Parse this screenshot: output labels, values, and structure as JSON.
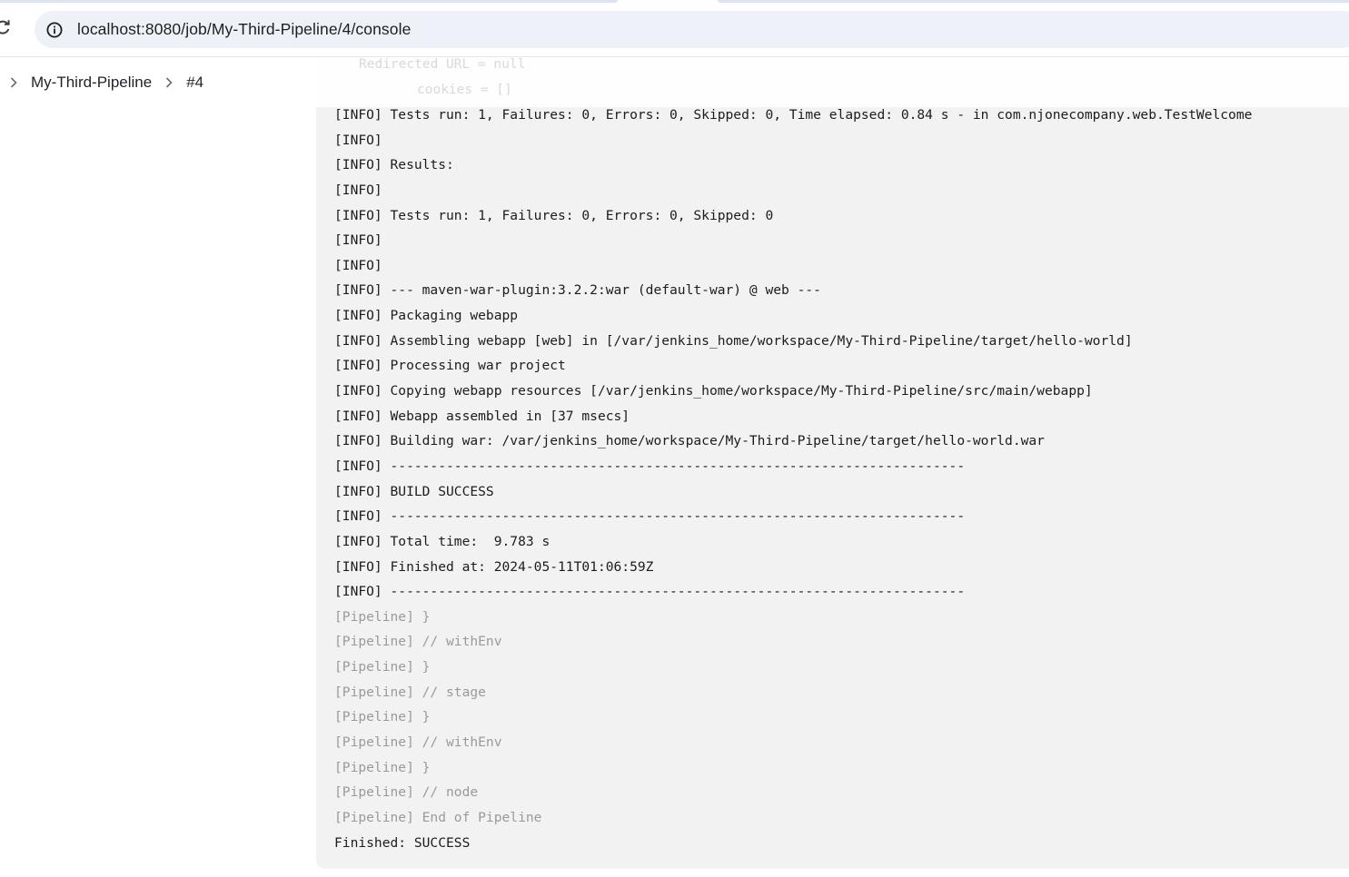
{
  "browser": {
    "url": "localhost:8080/job/My-Third-Pipeline/4/console",
    "reload_icon": "reload-icon",
    "site_info_icon": "info-circle-icon"
  },
  "breadcrumb": {
    "items": [
      {
        "label": "My-Third-Pipeline"
      },
      {
        "label": "#4"
      }
    ],
    "separator_icon": "chevron-right-icon"
  },
  "ghost_text": {
    "line1": "Redirected URL = null",
    "line2": "cookies = []"
  },
  "console": {
    "lines": [
      {
        "text": "[INFO] Tests run: 1, Failures: 0, Errors: 0, Skipped: 0, Time elapsed: 0.84 s - in com.njonecompany.web.TestWelcome",
        "kind": "info"
      },
      {
        "text": "[INFO]",
        "kind": "info"
      },
      {
        "text": "[INFO] Results:",
        "kind": "info"
      },
      {
        "text": "[INFO]",
        "kind": "info"
      },
      {
        "text": "[INFO] Tests run: 1, Failures: 0, Errors: 0, Skipped: 0",
        "kind": "info"
      },
      {
        "text": "[INFO]",
        "kind": "info"
      },
      {
        "text": "[INFO]",
        "kind": "info"
      },
      {
        "text": "[INFO] --- maven-war-plugin:3.2.2:war (default-war) @ web ---",
        "kind": "info"
      },
      {
        "text": "[INFO] Packaging webapp",
        "kind": "info"
      },
      {
        "text": "[INFO] Assembling webapp [web] in [/var/jenkins_home/workspace/My-Third-Pipeline/target/hello-world]",
        "kind": "info"
      },
      {
        "text": "[INFO] Processing war project",
        "kind": "info"
      },
      {
        "text": "[INFO] Copying webapp resources [/var/jenkins_home/workspace/My-Third-Pipeline/src/main/webapp]",
        "kind": "info"
      },
      {
        "text": "[INFO] Webapp assembled in [37 msecs]",
        "kind": "info"
      },
      {
        "text": "[INFO] Building war: /var/jenkins_home/workspace/My-Third-Pipeline/target/hello-world.war",
        "kind": "info"
      },
      {
        "text": "[INFO] ------------------------------------------------------------------------",
        "kind": "info"
      },
      {
        "text": "[INFO] BUILD SUCCESS",
        "kind": "info"
      },
      {
        "text": "[INFO] ------------------------------------------------------------------------",
        "kind": "info"
      },
      {
        "text": "[INFO] Total time:  9.783 s",
        "kind": "info"
      },
      {
        "text": "[INFO] Finished at: 2024-05-11T01:06:59Z",
        "kind": "info"
      },
      {
        "text": "[INFO] ------------------------------------------------------------------------",
        "kind": "info"
      },
      {
        "text": "[Pipeline] }",
        "kind": "pipeline"
      },
      {
        "text": "[Pipeline] // withEnv",
        "kind": "pipeline"
      },
      {
        "text": "[Pipeline] }",
        "kind": "pipeline"
      },
      {
        "text": "[Pipeline] // stage",
        "kind": "pipeline"
      },
      {
        "text": "[Pipeline] }",
        "kind": "pipeline"
      },
      {
        "text": "[Pipeline] // withEnv",
        "kind": "pipeline"
      },
      {
        "text": "[Pipeline] }",
        "kind": "pipeline"
      },
      {
        "text": "[Pipeline] // node",
        "kind": "pipeline"
      },
      {
        "text": "[Pipeline] End of Pipeline",
        "kind": "pipeline"
      },
      {
        "text": "Finished: SUCCESS",
        "kind": "info"
      }
    ]
  },
  "colors": {
    "console_background": "#f2f2f2",
    "info_text": "#1c1c1c",
    "pipeline_text": "#9a9a9a",
    "address_bar": "#eef1f8"
  }
}
